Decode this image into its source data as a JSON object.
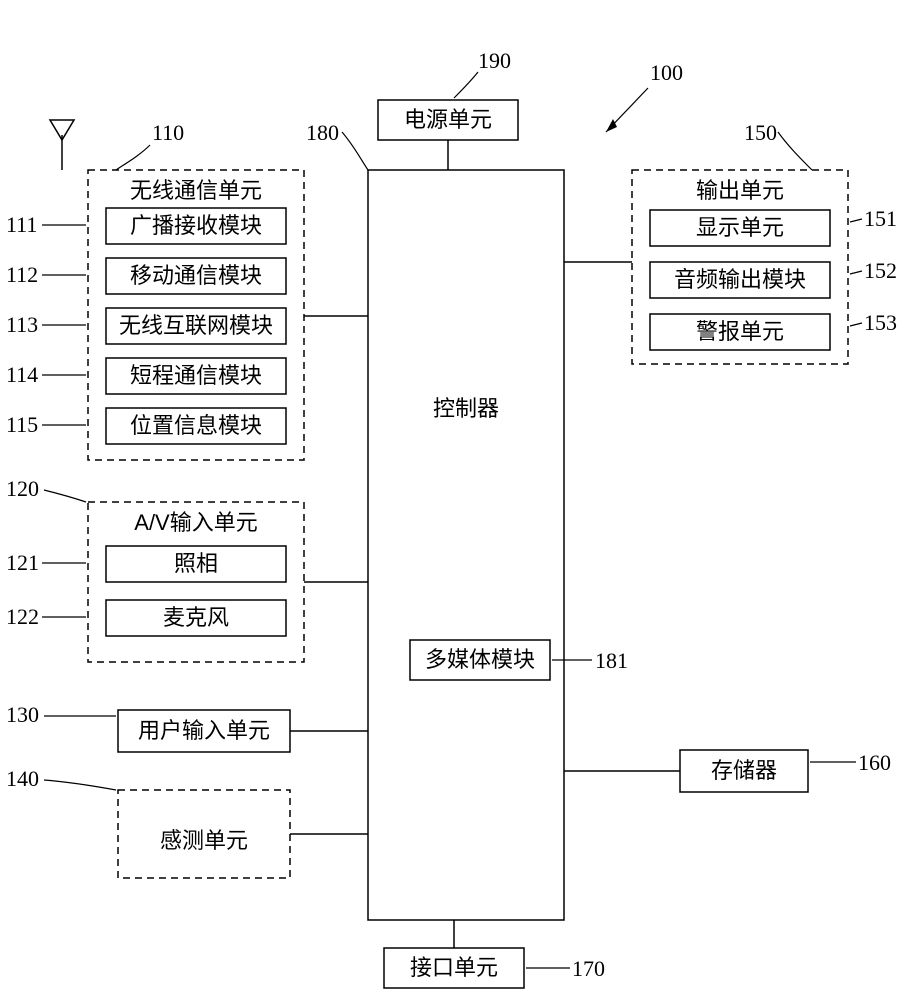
{
  "diagram": {
    "topbar": {
      "power": {
        "ref": "190",
        "label": "电源单元"
      },
      "device": {
        "ref": "100"
      }
    },
    "controller": {
      "ref": "180",
      "label": "控制器",
      "multimedia": {
        "ref": "181",
        "label": "多媒体模块"
      }
    },
    "wireless": {
      "ref": "110",
      "title": "无线通信单元",
      "items": [
        {
          "ref": "111",
          "label": "广播接收模块"
        },
        {
          "ref": "112",
          "label": "移动通信模块"
        },
        {
          "ref": "113",
          "label": "无线互联网模块"
        },
        {
          "ref": "114",
          "label": "短程通信模块"
        },
        {
          "ref": "115",
          "label": "位置信息模块"
        }
      ]
    },
    "av": {
      "ref": "120",
      "title": "A/V输入单元",
      "items": [
        {
          "ref": "121",
          "label": "照相"
        },
        {
          "ref": "122",
          "label": "麦克风"
        }
      ]
    },
    "userInput": {
      "ref": "130",
      "label": "用户输入单元"
    },
    "sensing": {
      "ref": "140",
      "label": "感测单元"
    },
    "output": {
      "ref": "150",
      "title": "输出单元",
      "items": [
        {
          "ref": "151",
          "label": "显示单元"
        },
        {
          "ref": "152",
          "label": "音频输出模块"
        },
        {
          "ref": "153",
          "label": "警报单元"
        }
      ]
    },
    "storage": {
      "ref": "160",
      "label": "存储器"
    },
    "interface": {
      "ref": "170",
      "label": "接口单元"
    }
  }
}
